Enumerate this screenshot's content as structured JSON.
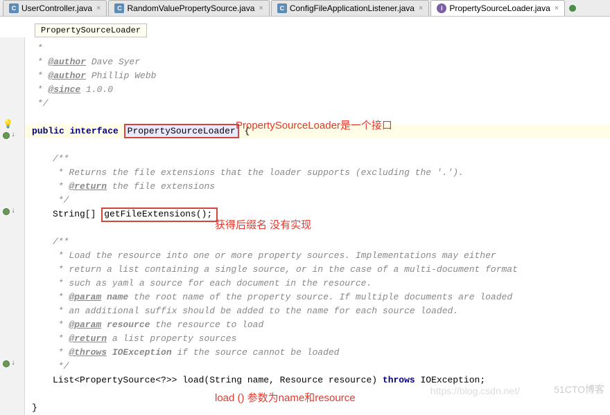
{
  "tabs": [
    {
      "icon": "C",
      "label": "UserController.java",
      "active": false
    },
    {
      "icon": "C",
      "label": "RandomValuePropertySource.java",
      "active": false
    },
    {
      "icon": "C",
      "label": "ConfigFileApplicationListener.java",
      "active": false
    },
    {
      "icon": "I",
      "label": "PropertySourceLoader.java",
      "active": true
    }
  ],
  "breadcrumb": "PropertySourceLoader",
  "code": {
    "l1": " *",
    "l2a": " * ",
    "l2b": "@author",
    "l2c": " Dave Syer",
    "l3a": " * ",
    "l3b": "@author",
    "l3c": " Phillip Webb",
    "l4a": " * ",
    "l4b": "@since",
    "l4c": " 1.0.0",
    "l5": " */",
    "l6a": "public",
    "l6b": " interface",
    "l6c": "PropertySourceLoader",
    "l6d": " {",
    "l8": "/**",
    "l9": " * Returns the file extensions that the loader supports (excluding the '.').",
    "l10a": " * ",
    "l10b": "@return",
    "l10c": " the file extensions",
    "l11": " */",
    "l12a": "String[]",
    "l12b": "getFileExtensions();",
    "l14": "/**",
    "l15": " * Load the resource into one or more property sources. Implementations may either",
    "l16": " * return a list containing a single source, or in the case of a multi-document format",
    "l17": " * such as yaml a source for each document in the resource.",
    "l18a": " * ",
    "l18b": "@param",
    "l18c": " name",
    "l18d": " the root name of the property source. If multiple documents are loaded",
    "l19": " * an additional suffix should be added to the name for each source loaded.",
    "l20a": " * ",
    "l20b": "@param",
    "l20c": " resource",
    "l20d": " the resource to load",
    "l21a": " * ",
    "l21b": "@return",
    "l21c": " a list property sources",
    "l22a": " * ",
    "l22b": "@throws",
    "l22c": " IOException",
    "l22d": " if the source cannot be loaded",
    "l23": " */",
    "l24a": "List<PropertySource<?>> load(String name, Resource resource) ",
    "l24b": "throws",
    "l24c": " IOException;",
    "l26": "}"
  },
  "annotations": {
    "a1": "PropertySourceLoader是一个接口",
    "a2": "获得后缀名  没有实现",
    "a3": "load () 参数为name和resource"
  },
  "watermark": {
    "w1": "https://blog.csdn.net/",
    "w2": "51CTO博客"
  }
}
